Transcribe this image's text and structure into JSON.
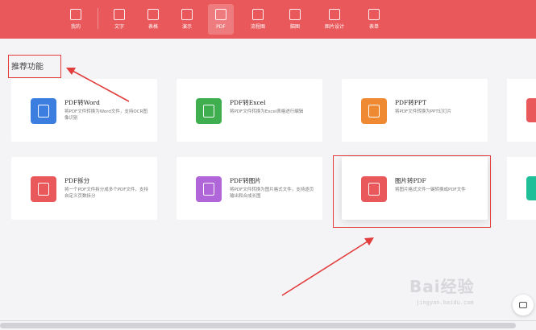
{
  "toolbar": {
    "items": [
      {
        "label": "我的",
        "icon": "star-icon"
      },
      {
        "label": "文字",
        "icon": "document-icon"
      },
      {
        "label": "表格",
        "icon": "table-icon"
      },
      {
        "label": "演示",
        "icon": "presentation-icon"
      },
      {
        "label": "PDF",
        "icon": "pdf-icon",
        "active": true
      },
      {
        "label": "流程图",
        "icon": "flowchart-icon"
      },
      {
        "label": "脑图",
        "icon": "mindmap-icon"
      },
      {
        "label": "图片设计",
        "icon": "image-design-icon"
      },
      {
        "label": "表单",
        "icon": "form-icon"
      }
    ],
    "color": "#e9585b"
  },
  "section": {
    "title": "推荐功能"
  },
  "cards": [
    {
      "title": "PDF转Word",
      "desc": "将PDF文件转换为Word文件，支持OCR图像识别",
      "color": "#3c7de0"
    },
    {
      "title": "PDF转Excel",
      "desc": "将PDF文件转换为Excel表格进行编辑",
      "color": "#3fae4e"
    },
    {
      "title": "PDF转PPT",
      "desc": "将PDF文件转换为PPT幻灯片",
      "color": "#f08a32"
    },
    {
      "title": "PDF拆分",
      "desc": "将一个PDF文件拆分成多个PDF文件，支持自定义页数拆分",
      "color": "#e9585b"
    },
    {
      "title": "PDF转图片",
      "desc": "将PDF文件转换为图片格式文件，支持逐页输出和合成长图",
      "color": "#b065d8"
    },
    {
      "title": "图片转PDF",
      "desc": "将图片格式文件一键转换成PDF文件",
      "color": "#e9585b"
    }
  ],
  "partial_colors": [
    "#e9585b",
    "#1fbf9a"
  ],
  "watermark": {
    "title": "Bai经验",
    "sub": "jingyan.baidu.com"
  },
  "annotation_color": "#e23d3d"
}
